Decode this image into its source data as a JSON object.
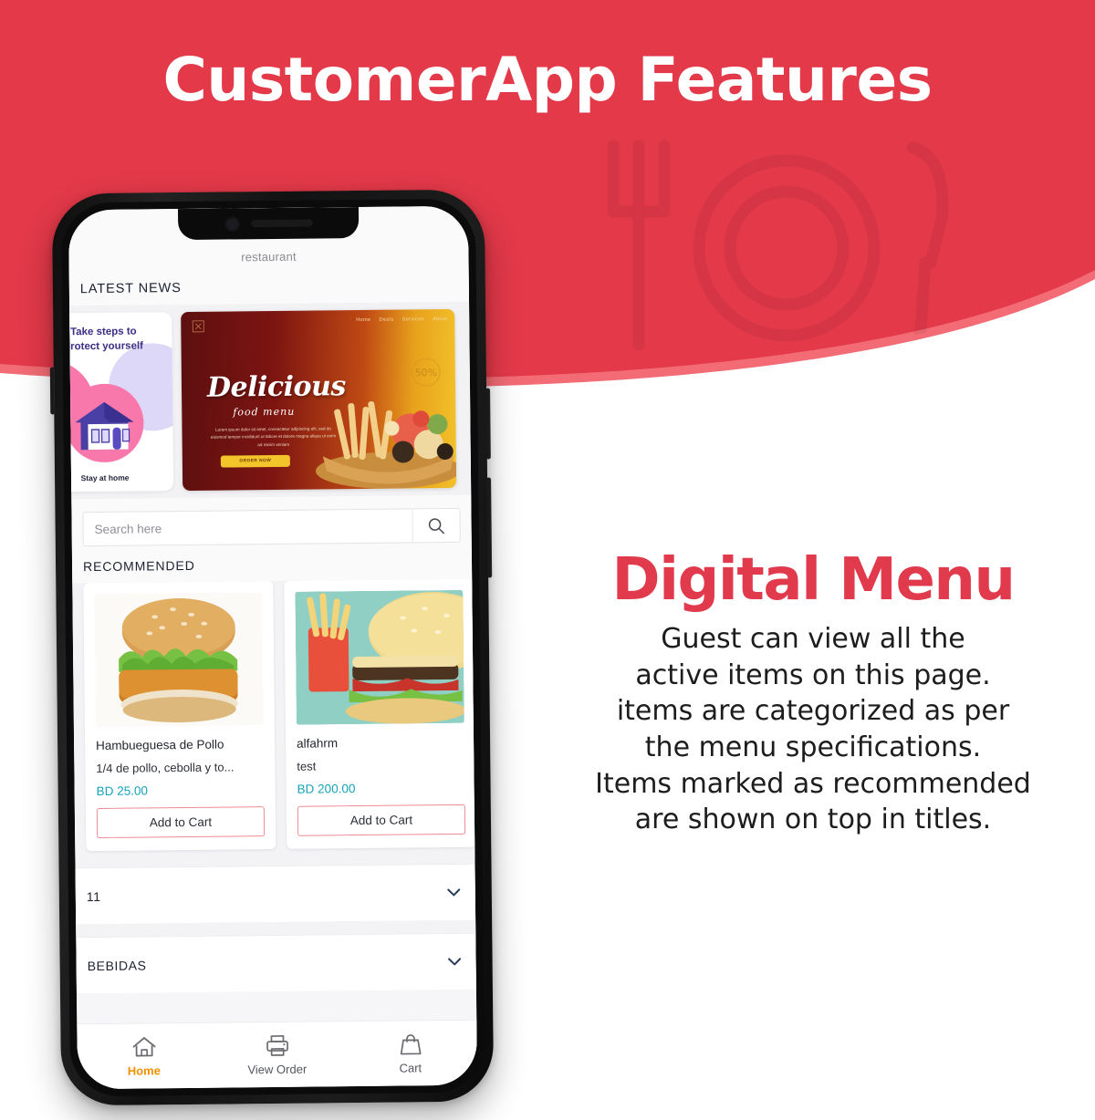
{
  "colors": {
    "banner_red": "#e33949",
    "banner_edge_pink": "#f26b75",
    "accent_red": "#e03a4c",
    "price_teal": "#17a2b8",
    "active_tab_orange": "#f29100",
    "add_to_cart_border": "#f08a95"
  },
  "header": {
    "title": "CustomerApp Features",
    "watermark_icon": "fork-plate-knife-icon"
  },
  "phone": {
    "app_title": "restaurant",
    "notch": {
      "camera_icon": "front-camera-icon",
      "speaker_icon": "earpiece-speaker-icon"
    },
    "latest_news": {
      "section_label": "LATEST NEWS",
      "cards": [
        {
          "type": "promo-covid",
          "headline": "Take steps to\nprotect yourself",
          "footer": "Stay at home",
          "illustration": "house-icon"
        },
        {
          "type": "promo-food",
          "title": "Delicious",
          "subtitle": "food menu",
          "body": "Lorem ipsum dolor sit amet, consectetur adipiscing elit, sed do eiusmod tempor incididunt ut labore et dolore magna aliqua ut enim ad minim veniam",
          "button": "ORDER NOW",
          "nav": [
            "Home",
            "Deals",
            "Services",
            "About"
          ],
          "badge": "50%"
        }
      ]
    },
    "search": {
      "placeholder": "Search here",
      "value": "",
      "icon": "search-icon"
    },
    "recommended": {
      "section_label": "RECOMMENDED",
      "items": [
        {
          "name": "Hambueguesa de Pollo",
          "description": "1/4 de pollo, cebolla y to...",
          "price": "BD 25.00",
          "button": "Add to Cart",
          "image": "chicken-burger-photo"
        },
        {
          "name": "alfahrm",
          "description": "test",
          "price": "BD 200.00",
          "button": "Add to Cart",
          "image": "burger-fries-photo"
        }
      ]
    },
    "categories": [
      {
        "label": "11",
        "chevron": "chevron-down-icon"
      },
      {
        "label": "BEBIDAS",
        "chevron": "chevron-down-icon"
      }
    ],
    "tabbar": [
      {
        "label": "Home",
        "icon": "home-icon",
        "active": true
      },
      {
        "label": "View Order",
        "icon": "printer-icon",
        "active": false
      },
      {
        "label": "Cart",
        "icon": "shopping-bag-icon",
        "active": false
      }
    ]
  },
  "feature": {
    "title": "Digital Menu",
    "lines": [
      "Guest can view all the",
      "active items on this page.",
      "items are categorized as per",
      "the menu specifications.",
      "Items marked as recommended",
      "are shown on top in titles."
    ]
  }
}
